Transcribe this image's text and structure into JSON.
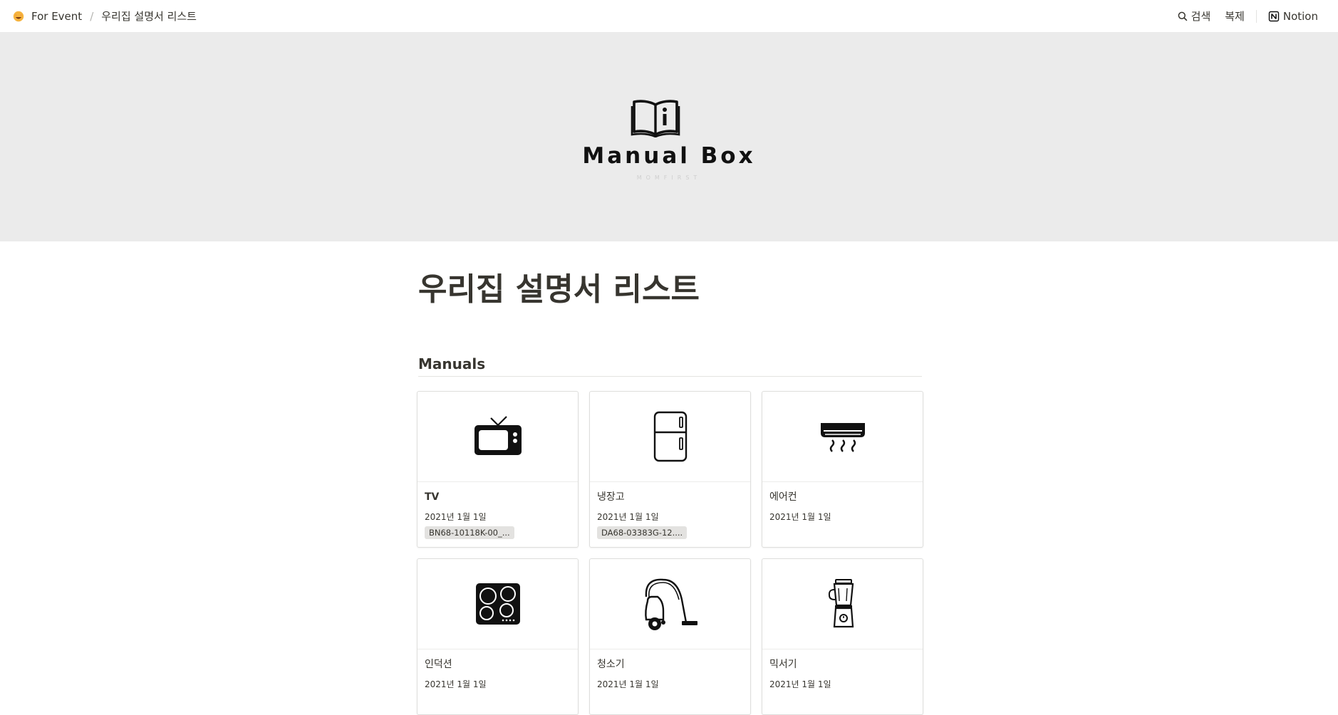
{
  "topbar": {
    "breadcrumb": [
      "For Event",
      "우리집 설명서 리스트"
    ],
    "actions": {
      "search": "검색",
      "duplicate": "복제",
      "notion": "Notion"
    }
  },
  "cover": {
    "brand": "Manual Box",
    "sub": "MOMFIRST"
  },
  "page": {
    "title": "우리집 설명서 리스트"
  },
  "database": {
    "title": "Manuals",
    "cards": [
      {
        "name": "TV",
        "date": "2021년 1월 1일",
        "tag": "BN68-10118K-00_...",
        "icon": "tv-icon"
      },
      {
        "name": "냉장고",
        "date": "2021년 1월 1일",
        "tag": "DA68-03383G-12....",
        "icon": "refrigerator-icon"
      },
      {
        "name": "에어컨",
        "date": "2021년 1월 1일",
        "tag": "",
        "icon": "air-conditioner-icon"
      },
      {
        "name": "인덕션",
        "date": "2021년 1월 1일",
        "tag": "",
        "icon": "induction-cooktop-icon"
      },
      {
        "name": "청소기",
        "date": "2021년 1월 1일",
        "tag": "",
        "icon": "vacuum-cleaner-icon"
      },
      {
        "name": "믹서기",
        "date": "2021년 1월 1일",
        "tag": "",
        "icon": "blender-icon"
      }
    ]
  }
}
